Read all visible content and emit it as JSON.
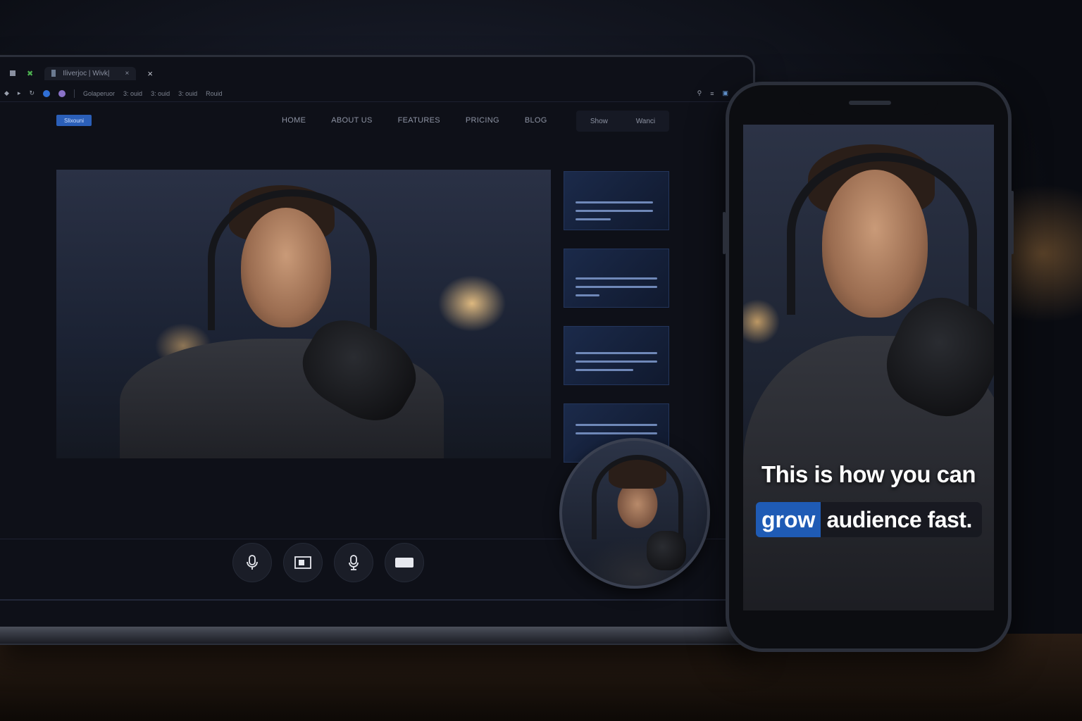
{
  "browser": {
    "tab_title": "Iliverjoc | Wivk|",
    "tab_close": "×",
    "new_tab_close": "×",
    "address_items": [
      "Golaperuor",
      "3: ouid",
      "3: ouid",
      "3: ouid",
      "Rouid"
    ]
  },
  "site": {
    "logo": "Slixouni",
    "nav": [
      "HOME",
      "ABOUT US",
      "FEATURES",
      "PRICING",
      "BLOG"
    ],
    "actions": [
      "Show",
      "Wanci"
    ]
  },
  "thumbnails_count": 4,
  "controls": [
    {
      "icon": "microphone-icon"
    },
    {
      "icon": "screen-share-icon"
    },
    {
      "icon": "microphone-alt-icon"
    },
    {
      "icon": "camera-icon"
    }
  ],
  "phone": {
    "caption_line1": "This is how you can",
    "caption_highlight": "grow",
    "caption_rest": "audience fast."
  },
  "colors": {
    "accent": "#1f5bb5",
    "background": "#12151f"
  }
}
